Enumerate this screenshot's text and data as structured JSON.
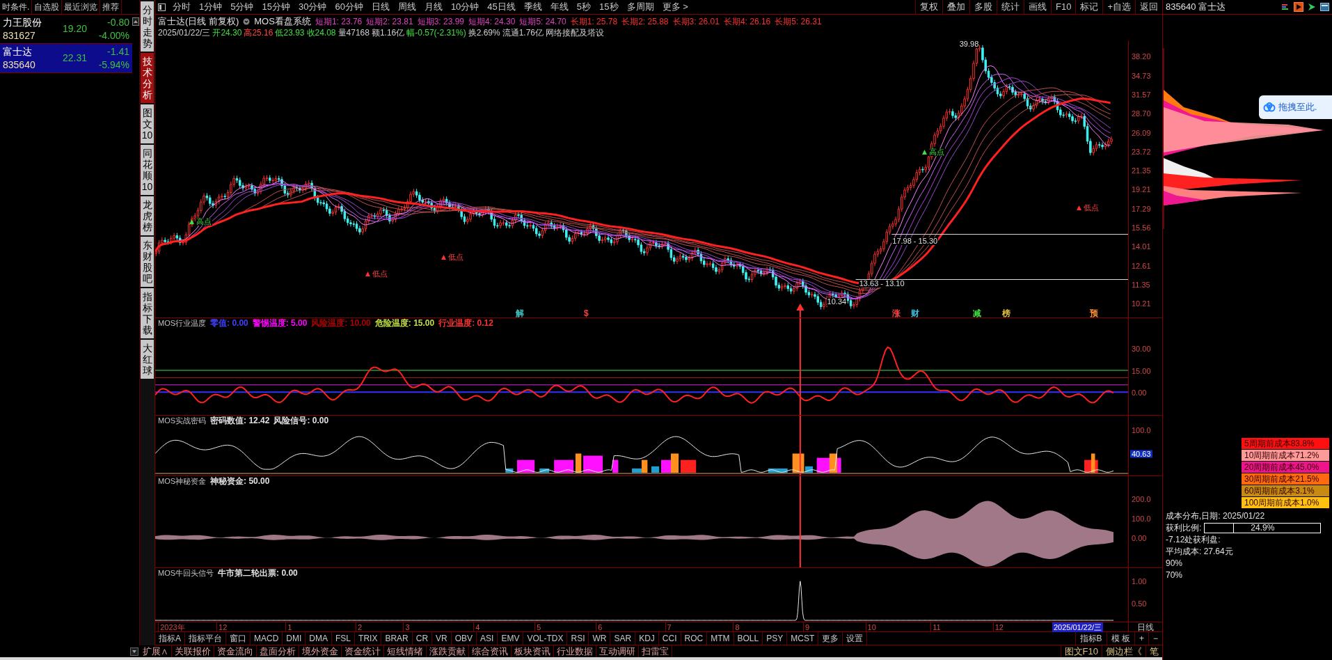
{
  "watchlist": {
    "tabs": [
      "时条件.",
      "自选股",
      "最近浏览",
      "推荐"
    ],
    "rows": [
      {
        "name": "力王股份",
        "code": "831627",
        "price": "19.20",
        "change": "-0.80",
        "pct": "-4.00%",
        "selected": false
      },
      {
        "name": "富士达",
        "code": "835640",
        "price": "22.31",
        "change": "-1.41",
        "pct": "-5.94%",
        "selected": true
      }
    ]
  },
  "side_tabs": [
    {
      "label": "分时走势",
      "selected": false
    },
    {
      "label": "技术分析",
      "selected": true
    },
    {
      "label": "图文10",
      "selected": false
    },
    {
      "label": "同花顺10",
      "selected": false
    },
    {
      "label": "龙虎榜",
      "selected": false
    },
    {
      "label": "东财股吧",
      "selected": false
    },
    {
      "label": "指标下载",
      "selected": false
    },
    {
      "label": "大红球",
      "selected": false
    }
  ],
  "period_bar": {
    "periods": [
      "分时",
      "1分钟",
      "5分钟",
      "15分钟",
      "30分钟",
      "60分钟",
      "日线",
      "周线",
      "月线",
      "10分钟",
      "45日线",
      "季线",
      "年线",
      "5秒",
      "15秒",
      "多周期",
      "更多 >"
    ],
    "tools": [
      "复权",
      "叠加",
      "多股",
      "统计",
      "画线",
      "F10",
      "标记",
      "+自选",
      "返回"
    ]
  },
  "chart_header": {
    "title": "富士达(日线 前复权)",
    "system": "MOS看盘系统",
    "ma": [
      {
        "text": "短期1: 23.76",
        "color": "#e040c0"
      },
      {
        "text": "短期2: 23.81",
        "color": "#e040c0"
      },
      {
        "text": "短期3: 23.99",
        "color": "#e040c0"
      },
      {
        "text": "短期4: 24.30",
        "color": "#e040c0"
      },
      {
        "text": "短期5: 24.70",
        "color": "#e040c0"
      },
      {
        "text": "长期1: 25.78",
        "color": "#ff3030"
      },
      {
        "text": "长期2: 25.88",
        "color": "#ff3030"
      },
      {
        "text": "长期3: 26.01",
        "color": "#ff3030"
      },
      {
        "text": "长期4: 26.16",
        "color": "#ff3030"
      },
      {
        "text": "长期5: 26.31",
        "color": "#ff3030"
      }
    ],
    "quote": [
      {
        "text": "2025/01/22/三",
        "color": "#d0d0d0"
      },
      {
        "text": "开24.30",
        "color": "#40e040"
      },
      {
        "text": "高25.16",
        "color": "#ff4040"
      },
      {
        "text": "低23.93",
        "color": "#40e040"
      },
      {
        "text": "收24.08",
        "color": "#40e040"
      },
      {
        "text": "量47168",
        "color": "#d0d0d0"
      },
      {
        "text": "额1.16亿",
        "color": "#d0d0d0"
      },
      {
        "text": "幅-0.57(-2.31%)",
        "color": "#40e040"
      },
      {
        "text": "换2.69%",
        "color": "#d0d0d0"
      },
      {
        "text": "流通1.76亿",
        "color": "#d0d0d0"
      },
      {
        "text": "网络接配及塔设",
        "color": "#d0d0d0"
      }
    ]
  },
  "main_chart": {
    "y_labels": [
      "38.20",
      "34.73",
      "31.57",
      "28.70",
      "26.09",
      "23.72",
      "21.35",
      "19.21",
      "17.29",
      "15.56",
      "14.01",
      "12.61",
      "11.35",
      "10.21"
    ],
    "annotations": [
      {
        "text": "39.98",
        "kind": "price"
      },
      {
        "text": "10.34",
        "kind": "price"
      },
      {
        "text": "17.98 - 15.30",
        "kind": "range"
      },
      {
        "text": "13.63 - 13.10",
        "kind": "range"
      },
      {
        "text": "高点",
        "kind": "high"
      },
      {
        "text": "高点",
        "kind": "high"
      },
      {
        "text": "低点",
        "kind": "low"
      },
      {
        "text": "低点",
        "kind": "low"
      },
      {
        "text": "低点",
        "kind": "low"
      }
    ],
    "markers": [
      {
        "text": "解",
        "color": "#40c0c0"
      },
      {
        "text": "$",
        "color": "#ff4040"
      },
      {
        "text": "涨",
        "color": "#ff4040"
      },
      {
        "text": "财",
        "color": "#40c0e0"
      },
      {
        "text": "减",
        "color": "#40e040"
      },
      {
        "text": "榜",
        "color": "#e0c040"
      },
      {
        "text": "预",
        "color": "#ff9030"
      }
    ]
  },
  "indicators": [
    {
      "kind": "temperature",
      "title": "MOS行业温度",
      "values": [
        {
          "text": "零值: 0.00",
          "color": "#4040ff"
        },
        {
          "text": "警惕温度: 5.00",
          "color": "#ff00ff"
        },
        {
          "text": "风险温度: 10.00",
          "color": "#b00000"
        },
        {
          "text": "危险温度: 15.00",
          "color": "#c0e040"
        },
        {
          "text": "行业温度: 0.12",
          "color": "#ff3030"
        }
      ],
      "y_labels": [
        {
          "text": "30.00",
          "highlighted": false
        },
        {
          "text": "15.00",
          "highlighted": false
        },
        {
          "text": "0.00",
          "highlighted": false
        }
      ]
    },
    {
      "kind": "code",
      "title": "MOS实战密码",
      "values": [
        {
          "text": "密码数值: 12.42",
          "color": "#e0e0e0"
        },
        {
          "text": "风险信号: 0.00",
          "color": "#e0e0e0"
        }
      ],
      "y_labels": [
        {
          "text": "100.0",
          "highlighted": false
        },
        {
          "text": "40.63",
          "highlighted": true
        }
      ]
    },
    {
      "kind": "fund",
      "title": "MOS神秘资金",
      "values": [
        {
          "text": "神秘资金: 50.00",
          "color": "#e0e0e0"
        }
      ],
      "y_labels": [
        {
          "text": "200.0",
          "highlighted": false
        },
        {
          "text": "100.0",
          "highlighted": false
        },
        {
          "text": "0.00",
          "highlighted": false
        }
      ]
    },
    {
      "kind": "signal",
      "title": "MOS牛回头信号",
      "values": [
        {
          "text": "牛市第二轮出票: 0.00",
          "color": "#e0e0e0"
        }
      ],
      "y_labels": [
        {
          "text": "1.00",
          "highlighted": false
        },
        {
          "text": "0.50",
          "highlighted": false
        }
      ]
    }
  ],
  "date_axis": {
    "labels": [
      "2023年",
      "12",
      "1",
      "2",
      "3",
      "4",
      "5",
      "6",
      "7",
      "8",
      "9",
      "10",
      "11",
      "12"
    ],
    "current": "2025/01/22/三",
    "period": "日线"
  },
  "indicator_tabs": [
    "指标A",
    "指标平台",
    "窗口",
    "MACD",
    "DMI",
    "DMA",
    "FSL",
    "TRIX",
    "BRAR",
    "CR",
    "VR",
    "OBV",
    "ASI",
    "EMV",
    "VOL-TDX",
    "RSI",
    "WR",
    "SAR",
    "KDJ",
    "CCI",
    "ROC",
    "MTM",
    "BOLL",
    "PSY",
    "MCST",
    "更多",
    "设置"
  ],
  "indicator_tools": [
    "指标B",
    "模 板",
    "+",
    "−"
  ],
  "bottom_tabs": [
    "扩展∧",
    "关联报价",
    "资金流向",
    "盘面分析",
    "境外资金",
    "资金统计",
    "短线情绪",
    "涨跌贡献",
    "综合资讯",
    "板块资讯",
    "行业数据",
    "互动调研",
    "扫雷宝"
  ],
  "bottom_tools": [
    "图文F10",
    "侧边栏《",
    "笔"
  ],
  "right_panel": {
    "title": "835640 富士达",
    "drag_hint": "拖拽至此.",
    "cost_legend": [
      {
        "text": "5周期前成本83.8%",
        "color": "#ff1010"
      },
      {
        "text": "10周期前成本71.2%",
        "color": "#ff9a9a"
      },
      {
        "text": "20周期前成本45.0%",
        "color": "#f0148c"
      },
      {
        "text": "30周期前成本21.5%",
        "color": "#ff6a10"
      },
      {
        "text": "60周期前成本3.1%",
        "color": "#c88a10"
      },
      {
        "text": "100周期前成本1.0%",
        "color": "#ffc010"
      }
    ],
    "cost_date": "成本分布,日期: 2025/01/22",
    "profit_label": "获利比例:",
    "profit": {
      "level": 0.249,
      "reading": "24.9%"
    },
    "profit_at": "-7.12处获利盘:",
    "avg_cost": "平均成本: 27.64元",
    "band_90": "90%",
    "band_70": "70%"
  }
}
